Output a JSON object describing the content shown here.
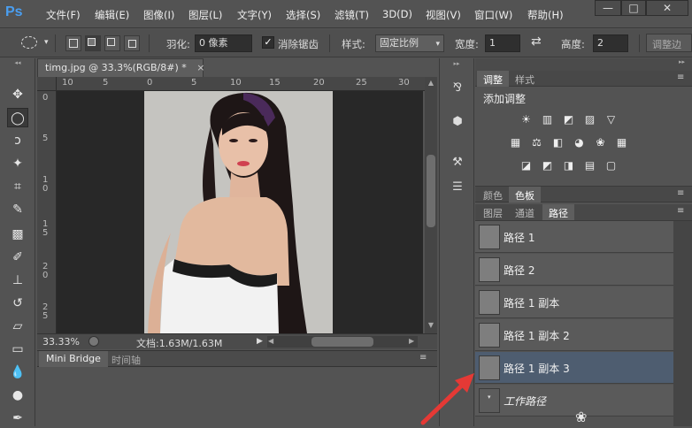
{
  "app": {
    "logo": "Ps"
  },
  "menu": [
    "文件(F)",
    "编辑(E)",
    "图像(I)",
    "图层(L)",
    "文字(Y)",
    "选择(S)",
    "滤镜(T)",
    "3D(D)",
    "视图(V)",
    "窗口(W)",
    "帮助(H)"
  ],
  "window_controls": {
    "minimize": "—",
    "maximize": "□",
    "close": "✕"
  },
  "options": {
    "feather_label": "羽化:",
    "feather_value": "0 像素",
    "antialias_label": "消除锯齿",
    "style_label": "样式:",
    "style_value": "固定比例",
    "width_label": "宽度:",
    "width_value": "1",
    "height_label": "高度:",
    "height_value": "2",
    "refine_label": "调整边"
  },
  "document": {
    "tab_title": "timg.jpg @ 33.3%(RGB/8#) *",
    "close": "×",
    "ruler_h": [
      "10",
      "5",
      "0",
      "5",
      "10",
      "15",
      "20",
      "25",
      "30"
    ],
    "ruler_v": [
      "0",
      "5",
      "1 0",
      "1 5",
      "2 0",
      "2 5"
    ]
  },
  "status": {
    "zoom": "33.33%",
    "doc_info": "文档:1.63M/1.63M"
  },
  "bottom_panel": {
    "tabs": [
      "Mini Bridge",
      "时间轴"
    ]
  },
  "adjustments": {
    "tabs": [
      "调整",
      "样式"
    ],
    "title": "添加调整",
    "row1": [
      "☀",
      "▥",
      "◩",
      "▨",
      "▽"
    ],
    "row2": [
      "▦",
      "⚖",
      "◧",
      "◕",
      "❀",
      "▦"
    ],
    "row3": [
      "◪",
      "◩",
      "◨",
      "▤",
      "▢"
    ]
  },
  "swatches": {
    "tabs": [
      "颜色",
      "色板"
    ]
  },
  "paths_panel": {
    "tabs": [
      "图层",
      "通道",
      "路径"
    ],
    "items": [
      "路径 1",
      "路径 2",
      "路径 1 副本",
      "路径 1 副本 2",
      "路径 1 副本 3",
      "工作路径"
    ],
    "selected_index": 4
  },
  "colors": {
    "accent": "#e53935",
    "selected_row": "#4e5d70",
    "logo": "#4a9ef0"
  }
}
